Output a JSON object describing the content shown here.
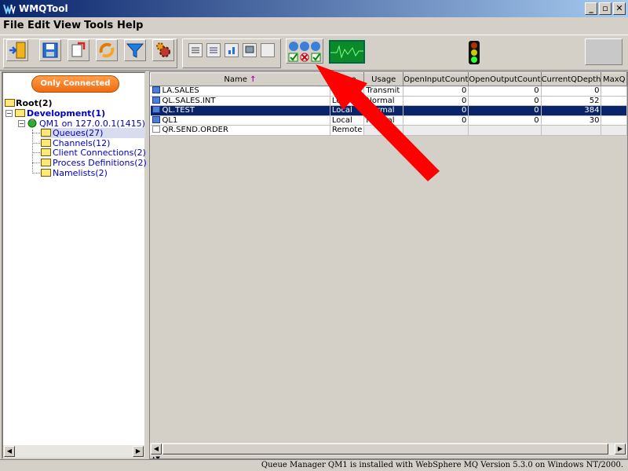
{
  "window": {
    "title": "WMQTool",
    "minimize": "_",
    "restore": "▫",
    "close": "✕"
  },
  "menu": [
    "File",
    "Edit",
    "View",
    "Tools",
    "Help"
  ],
  "filter_button": "Only Connected",
  "tree": {
    "root": "Root(2)",
    "development": "Development(1)",
    "qmgr": "QM1  on 127.0.0.1(1415)",
    "children": [
      "Queues(27)",
      "Channels(12)",
      "Client Connections(2)",
      "Process Definitions(2)",
      "Namelists(2)"
    ]
  },
  "table": {
    "sort_indicator": "↑",
    "columns": [
      "Name",
      "Type",
      "Usage",
      "OpenInputCount",
      "OpenOutputCount",
      "CurrentQDepth",
      "MaxQ"
    ],
    "rows": [
      {
        "name": "LA.SALES",
        "type": "Local",
        "usage": "Transmit",
        "in": "0",
        "out": "0",
        "depth": "0"
      },
      {
        "name": "QL.SALES.INT",
        "type": "Local",
        "usage": "Normal",
        "in": "0",
        "out": "0",
        "depth": "52"
      },
      {
        "name": "QL.TEST",
        "type": "Local",
        "usage": "Normal",
        "in": "0",
        "out": "0",
        "depth": "384"
      },
      {
        "name": "QL1",
        "type": "Local",
        "usage": "Normal",
        "in": "0",
        "out": "0",
        "depth": "30"
      },
      {
        "name": "QR.SEND.ORDER",
        "type": "Remote",
        "usage": "",
        "in": "",
        "out": "",
        "depth": ""
      }
    ],
    "selected_row": 2
  },
  "status": "Queue Manager QM1  is installed with WebSphere MQ Version 5.3.0 on Windows NT/2000.",
  "colors": {
    "selection": "#0a246a",
    "arrow": "#ff0000",
    "filter_button": "#ef6b10"
  }
}
